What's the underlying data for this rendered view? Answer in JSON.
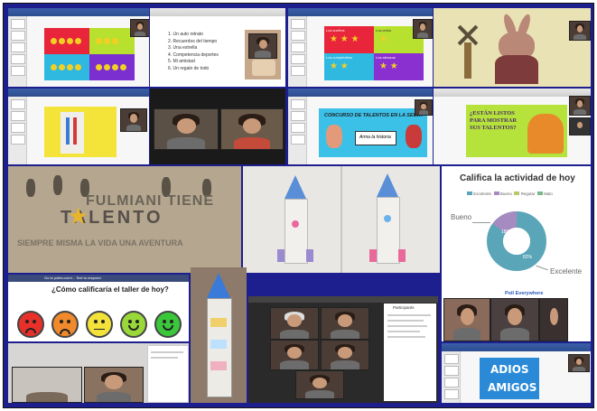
{
  "collage": {
    "slide_list": {
      "items": [
        "1. Un auto retrato",
        "2. Recuerdos del tiempo",
        "3. Una estrella",
        "4. Competencia deportes",
        "5. Mi amistad",
        "6. Un regalo de todo"
      ]
    },
    "color_grid_right": {
      "cells": [
        "Los sueños",
        "Los celos",
        "Los cumpleaños",
        "Los abrazos"
      ]
    },
    "talent_banner": {
      "title": "CONCURSO DE TALENTOS EN LA SELVA",
      "button": "Arma la historia"
    },
    "ready_slide": {
      "text": "¿ESTÁN LISTOS PARA MOSTRAR SUS TALENTOS?"
    },
    "fabric_banner": {
      "line1": "FULMIANI TIENE",
      "line2": "TALENTO",
      "line3": "SIEMPRE MISMA LA VIDA UNA AVENTURA"
    },
    "poll": {
      "title": "Califica la actividad de hoy",
      "legend": [
        "Excelente",
        "Bueno",
        "Regular",
        "Malo"
      ],
      "label_left": "Bueno",
      "label_right": "Excelente",
      "pct_small": "18%",
      "pct_big": "82%"
    },
    "workshop_rating": {
      "header": "Go to pollev.com/... Text to respond",
      "question": "¿Cómo calificaría el taller de hoy?"
    },
    "poll_everywhere": {
      "brand": "Poll Everywhere"
    },
    "goodbye": {
      "line1": "ADIOS",
      "line2": "AMIGOS"
    },
    "participants": {
      "title": "Participants"
    }
  },
  "colors": {
    "frame": "#1d1f8f",
    "poll_teal": "#5aa6b8",
    "poll_purple": "#a58bbf",
    "talent_banner": "#3bc0e8",
    "ready_slide": "#b5e23b"
  }
}
